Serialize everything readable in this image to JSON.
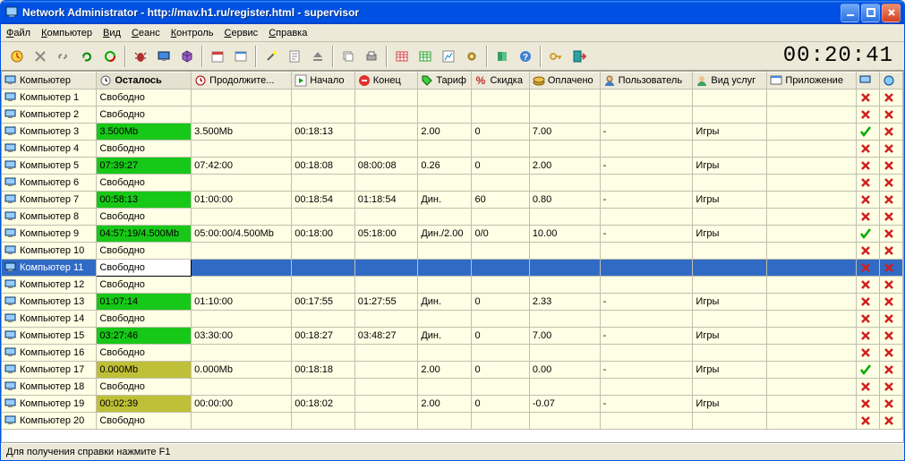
{
  "window": {
    "title": "Network Administrator - http://mav.h1.ru/register.html - supervisor"
  },
  "menu": [
    "Файл",
    "Компьютер",
    "Вид",
    "Сеанс",
    "Контроль",
    "Сервис",
    "Справка"
  ],
  "clock": "00:20:41",
  "statusbar": "Для получения справки нажмите F1",
  "columns": [
    {
      "key": "computer",
      "label": "Компьютер",
      "icon": "computer-icon"
    },
    {
      "key": "remain",
      "label": "Осталось",
      "icon": "clock-icon",
      "sorted": true
    },
    {
      "key": "duration",
      "label": "Продолжите...",
      "icon": "clock-red-icon"
    },
    {
      "key": "start",
      "label": "Начало",
      "icon": "play-icon"
    },
    {
      "key": "end",
      "label": "Конец",
      "icon": "stop-icon"
    },
    {
      "key": "tariff",
      "label": "Тариф",
      "icon": "tag-icon"
    },
    {
      "key": "discount",
      "label": "Скидка",
      "icon": "percent-icon"
    },
    {
      "key": "paid",
      "label": "Оплачено",
      "icon": "money-icon"
    },
    {
      "key": "user",
      "label": "Пользователь",
      "icon": "user-icon"
    },
    {
      "key": "service",
      "label": "Вид услуг",
      "icon": "service-icon"
    },
    {
      "key": "app",
      "label": "Приложение",
      "icon": "app-icon"
    },
    {
      "key": "s1",
      "label": "",
      "icon": "net1-icon"
    },
    {
      "key": "s2",
      "label": "",
      "icon": "net2-icon"
    }
  ],
  "rows": [
    {
      "computer": "Компьютер 1",
      "remain": "Свободно",
      "color": "",
      "duration": "",
      "start": "",
      "end": "",
      "tariff": "",
      "discount": "",
      "paid": "",
      "user": "",
      "service": "",
      "app": "",
      "s1": "x",
      "s2": "x"
    },
    {
      "computer": "Компьютер 2",
      "remain": "Свободно",
      "color": "",
      "duration": "",
      "start": "",
      "end": "",
      "tariff": "",
      "discount": "",
      "paid": "",
      "user": "",
      "service": "",
      "app": "",
      "s1": "x",
      "s2": "x"
    },
    {
      "computer": "Компьютер 3",
      "remain": "3.500Mb",
      "color": "green",
      "duration": "3.500Mb",
      "start": "00:18:13",
      "end": "",
      "tariff": "2.00",
      "discount": "0",
      "paid": "7.00",
      "user": "-",
      "service": "Игры",
      "app": "",
      "s1": "v",
      "s2": "x"
    },
    {
      "computer": "Компьютер 4",
      "remain": "Свободно",
      "color": "",
      "duration": "",
      "start": "",
      "end": "",
      "tariff": "",
      "discount": "",
      "paid": "",
      "user": "",
      "service": "",
      "app": "",
      "s1": "x",
      "s2": "x"
    },
    {
      "computer": "Компьютер 5",
      "remain": "07:39:27",
      "color": "green",
      "duration": "07:42:00",
      "start": "00:18:08",
      "end": "08:00:08",
      "tariff": "0.26",
      "discount": "0",
      "paid": "2.00",
      "user": "-",
      "service": "Игры",
      "app": "",
      "s1": "x",
      "s2": "x"
    },
    {
      "computer": "Компьютер 6",
      "remain": "Свободно",
      "color": "",
      "duration": "",
      "start": "",
      "end": "",
      "tariff": "",
      "discount": "",
      "paid": "",
      "user": "",
      "service": "",
      "app": "",
      "s1": "x",
      "s2": "x"
    },
    {
      "computer": "Компьютер 7",
      "remain": "00:58:13",
      "color": "green",
      "duration": "01:00:00",
      "start": "00:18:54",
      "end": "01:18:54",
      "tariff": "Дин.",
      "discount": "60",
      "paid": "0.80",
      "user": "-",
      "service": "Игры",
      "app": "",
      "s1": "x",
      "s2": "x"
    },
    {
      "computer": "Компьютер 8",
      "remain": "Свободно",
      "color": "",
      "duration": "",
      "start": "",
      "end": "",
      "tariff": "",
      "discount": "",
      "paid": "",
      "user": "",
      "service": "",
      "app": "",
      "s1": "x",
      "s2": "x"
    },
    {
      "computer": "Компьютер 9",
      "remain": "04:57:19/4.500Mb",
      "color": "green",
      "duration": "05:00:00/4.500Mb",
      "start": "00:18:00",
      "end": "05:18:00",
      "tariff": "Дин./2.00",
      "discount": "0/0",
      "paid": "10.00",
      "user": "-",
      "service": "Игры",
      "app": "",
      "s1": "v",
      "s2": "x"
    },
    {
      "computer": "Компьютер 10",
      "remain": "Свободно",
      "color": "",
      "duration": "",
      "start": "",
      "end": "",
      "tariff": "",
      "discount": "",
      "paid": "",
      "user": "",
      "service": "",
      "app": "",
      "s1": "x",
      "s2": "x"
    },
    {
      "computer": "Компьютер 11",
      "remain": "Свободно",
      "color": "",
      "duration": "",
      "start": "",
      "end": "",
      "tariff": "",
      "discount": "",
      "paid": "",
      "user": "",
      "service": "",
      "app": "",
      "s1": "x",
      "s2": "x",
      "selected": true
    },
    {
      "computer": "Компьютер 12",
      "remain": "Свободно",
      "color": "",
      "duration": "",
      "start": "",
      "end": "",
      "tariff": "",
      "discount": "",
      "paid": "",
      "user": "",
      "service": "",
      "app": "",
      "s1": "x",
      "s2": "x"
    },
    {
      "computer": "Компьютер 13",
      "remain": "01:07:14",
      "color": "green",
      "duration": "01:10:00",
      "start": "00:17:55",
      "end": "01:27:55",
      "tariff": "Дин.",
      "discount": "0",
      "paid": "2.33",
      "user": "-",
      "service": "Игры",
      "app": "",
      "s1": "x",
      "s2": "x"
    },
    {
      "computer": "Компьютер 14",
      "remain": "Свободно",
      "color": "",
      "duration": "",
      "start": "",
      "end": "",
      "tariff": "",
      "discount": "",
      "paid": "",
      "user": "",
      "service": "",
      "app": "",
      "s1": "x",
      "s2": "x"
    },
    {
      "computer": "Компьютер 15",
      "remain": "03:27:46",
      "color": "green",
      "duration": "03:30:00",
      "start": "00:18:27",
      "end": "03:48:27",
      "tariff": "Дин.",
      "discount": "0",
      "paid": "7.00",
      "user": "-",
      "service": "Игры",
      "app": "",
      "s1": "x",
      "s2": "x"
    },
    {
      "computer": "Компьютер 16",
      "remain": "Свободно",
      "color": "",
      "duration": "",
      "start": "",
      "end": "",
      "tariff": "",
      "discount": "",
      "paid": "",
      "user": "",
      "service": "",
      "app": "",
      "s1": "x",
      "s2": "x"
    },
    {
      "computer": "Компьютер 17",
      "remain": "0.000Mb",
      "color": "olive",
      "duration": "0.000Mb",
      "start": "00:18:18",
      "end": "",
      "tariff": "2.00",
      "discount": "0",
      "paid": "0.00",
      "user": "-",
      "service": "Игры",
      "app": "",
      "s1": "v",
      "s2": "x"
    },
    {
      "computer": "Компьютер 18",
      "remain": "Свободно",
      "color": "",
      "duration": "",
      "start": "",
      "end": "",
      "tariff": "",
      "discount": "",
      "paid": "",
      "user": "",
      "service": "",
      "app": "",
      "s1": "x",
      "s2": "x"
    },
    {
      "computer": "Компьютер 19",
      "remain": "00:02:39",
      "color": "olive",
      "duration": "00:00:00",
      "start": "00:18:02",
      "end": "",
      "tariff": "2.00",
      "discount": "0",
      "paid": "-0.07",
      "user": "-",
      "service": "Игры",
      "app": "",
      "s1": "x",
      "s2": "x"
    },
    {
      "computer": "Компьютер 20",
      "remain": "Свободно",
      "color": "",
      "duration": "",
      "start": "",
      "end": "",
      "tariff": "",
      "discount": "",
      "paid": "",
      "user": "",
      "service": "",
      "app": "",
      "s1": "x",
      "s2": "x"
    }
  ],
  "toolbar_icons": [
    "globe-clock",
    "delete",
    "link",
    "redo",
    "refresh",
    "sep",
    "bug",
    "monitor",
    "cube",
    "sep",
    "calendar",
    "window",
    "sep",
    "wand",
    "note",
    "eject",
    "sep",
    "copy",
    "print",
    "sep",
    "table-red",
    "table-green",
    "chart",
    "gear",
    "sep",
    "book",
    "help",
    "sep",
    "key",
    "exit"
  ]
}
